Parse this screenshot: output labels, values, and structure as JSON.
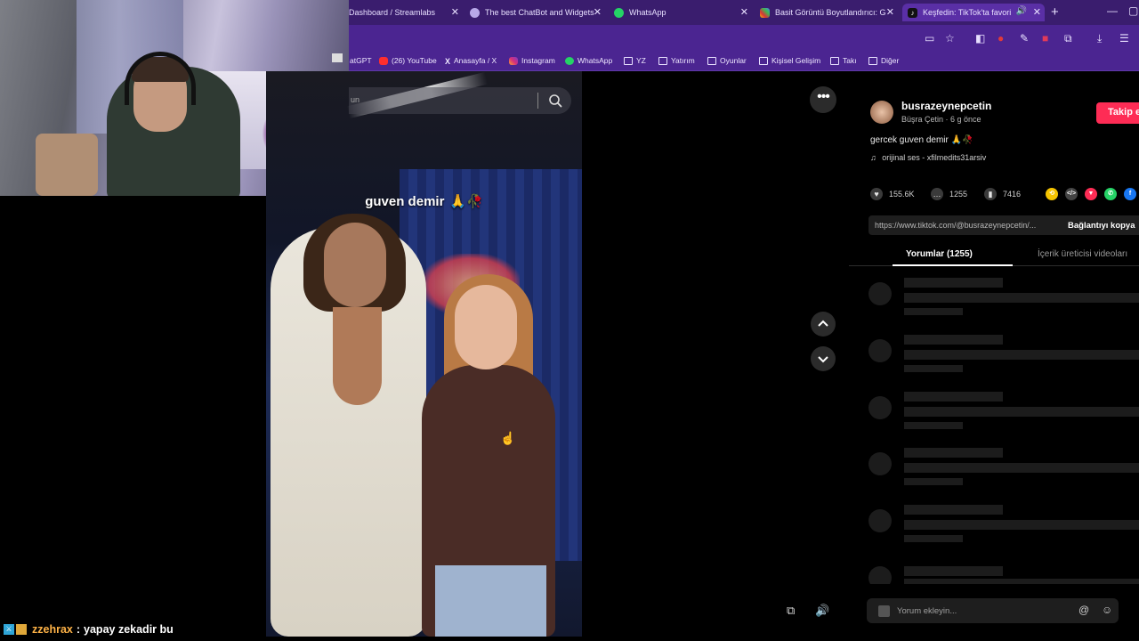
{
  "browser": {
    "tabs": [
      {
        "title": "Dashboard / Streamlabs",
        "icon": "streamlabs-icon",
        "active": false
      },
      {
        "title": "The best ChatBot and Widgets",
        "icon": "chatbot-icon",
        "active": false
      },
      {
        "title": "WhatsApp",
        "icon": "whatsapp-icon",
        "active": false
      },
      {
        "title": "Basit Görüntü Boyutlandırıcı: G",
        "icon": "image-resizer-icon",
        "active": false
      },
      {
        "title": "Keşfedin: TikTok'ta favori v",
        "icon": "tiktok-icon",
        "active": true
      }
    ],
    "bookmarks": [
      {
        "label": "atGPT",
        "icon": "chatgpt-icon"
      },
      {
        "label": "(26) YouTube",
        "icon": "youtube-icon"
      },
      {
        "label": "Anasayfa / X",
        "icon": "x-icon"
      },
      {
        "label": "Instagram",
        "icon": "instagram-icon"
      },
      {
        "label": "WhatsApp",
        "icon": "whatsapp-icon"
      },
      {
        "label": "YZ",
        "icon": "folder-icon"
      },
      {
        "label": "Yatırım",
        "icon": "folder-icon"
      },
      {
        "label": "Oyunlar",
        "icon": "folder-icon"
      },
      {
        "label": "Kişisel Gelişim",
        "icon": "folder-icon"
      },
      {
        "label": "Takı",
        "icon": "folder-icon"
      },
      {
        "label": "Diğer",
        "icon": "folder-icon"
      }
    ],
    "accent_color": "#4b2591"
  },
  "video": {
    "caption": "guven demir",
    "caption_emoji": "🙏🥀"
  },
  "search": {
    "placeholder": "un"
  },
  "post": {
    "username": "busrazeynepcetin",
    "display_name": "Büşra Çetin",
    "time_ago": "6 g önce",
    "subline": "Büşra Çetin · 6 g önce",
    "follow_label": "Takip e",
    "description": "gercek guven demir 🙏🥀",
    "sound_icon": "music-note-icon",
    "sound": "orijinal ses - xfilmedits31arsiv",
    "likes": "155.6K",
    "comments": "1255",
    "saves": "7416",
    "link": "https://www.tiktok.com/@busrazeynepcetin/...",
    "copy_link_label": "Bağlantıyı kopya",
    "tabs": {
      "comments": "Yorumlar (1255)",
      "creator_videos": "İçerik üreticisi videoları"
    },
    "comment_placeholder": "Yorum ekleyin...",
    "brand_color": "#fe2c55"
  },
  "stream_chat": {
    "user": "zzehrax",
    "separator": ":",
    "message": "yapay zekadir bu"
  }
}
